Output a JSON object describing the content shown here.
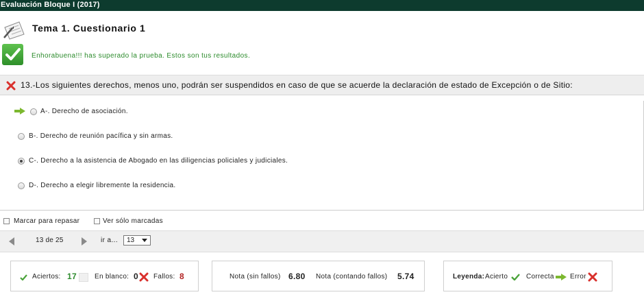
{
  "window": {
    "title": "Evaluación Bloque I (2017)"
  },
  "header": {
    "title": "Tema 1. Cuestionario 1",
    "icon": "document-pencil-icon"
  },
  "result": {
    "message": "Enhorabuena!!! has superado la prueba. Estos son tus resultados.",
    "icon": "check-icon"
  },
  "question": {
    "status": "incorrect",
    "text": "13.-Los siguientes derechos, menos uno, podrán ser suspendidos en caso de que se acuerde la declaración de estado de Excepción o de Sitio:",
    "options": [
      {
        "label": "A-. Derecho de asociación.",
        "selected": false,
        "correct": true
      },
      {
        "label": "B-. Derecho de reunión pacífica y sin armas.",
        "selected": false,
        "correct": false
      },
      {
        "label": "C-. Derecho a la asistencia de Abogado en las diligencias policiales y judiciales.",
        "selected": true,
        "correct": false
      },
      {
        "label": "D-. Derecho a elegir libremente la residencia.",
        "selected": false,
        "correct": false
      }
    ]
  },
  "filters": {
    "mark_label": "Marcar para repasar",
    "show_marked_label": "Ver sólo marcadas"
  },
  "navigation": {
    "counter": "13 de 25",
    "goto_label": "ir a...",
    "goto_value": "13"
  },
  "stats": {
    "hits_label": "Aciertos:",
    "hits": "17",
    "blank_label": "En blanco:",
    "blank": "0",
    "fails_label": "Fallos:",
    "fails": "8"
  },
  "grades": {
    "no_fail_label": "Nota (sin fallos)",
    "no_fail": "6.80",
    "with_fail_label": "Nota (contando fallos)",
    "with_fail": "5.74"
  },
  "legend": {
    "title": "Leyenda:",
    "hit": "Acierto",
    "correct": "Correcta",
    "error": "Error"
  },
  "colors": {
    "topbar": "#0d3b2e",
    "success_text": "#2a8a2a",
    "error_red": "#d9302c",
    "arrow_green": "#7cb82f"
  }
}
